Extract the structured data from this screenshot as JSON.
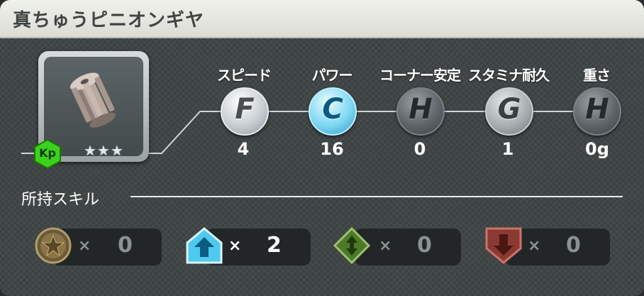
{
  "window": {
    "title": "真ちゅうピニオンギヤ"
  },
  "part": {
    "badge": "Kp",
    "stars": "★★★",
    "star_count": 3
  },
  "stats": [
    {
      "label": "スピード",
      "grade": "F",
      "value": "4"
    },
    {
      "label": "パワー",
      "grade": "C",
      "value": "16"
    },
    {
      "label": "コーナー安定",
      "grade": "H",
      "value": "0"
    },
    {
      "label": "スタミナ耐久",
      "grade": "G",
      "value": "1"
    },
    {
      "label": "重さ",
      "grade": "H",
      "value": "0g"
    }
  ],
  "skills": {
    "label": "所持スキル",
    "items": [
      {
        "icon": "star-medal-icon",
        "multiplier": "×",
        "count": "0"
      },
      {
        "icon": "blue-up-arrow-icon",
        "multiplier": "×",
        "count": "2"
      },
      {
        "icon": "green-diamond-updown-icon",
        "multiplier": "×",
        "count": "0"
      },
      {
        "icon": "red-down-arrow-icon",
        "multiplier": "×",
        "count": "0"
      }
    ]
  },
  "colors": {
    "grade_active": "#7fd8f2",
    "badge_green": "#35c21a",
    "title_bar": "#e8e8e2"
  }
}
